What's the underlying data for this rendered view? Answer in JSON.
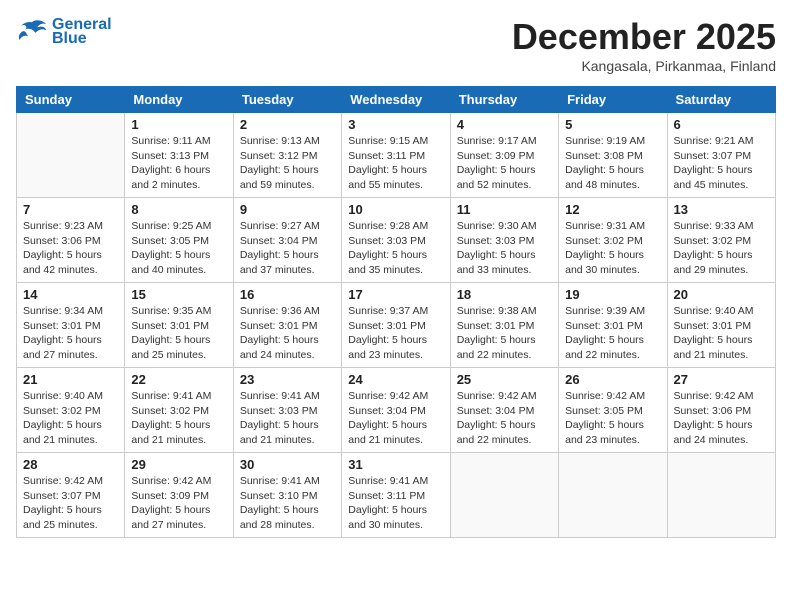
{
  "header": {
    "logo_line1": "General",
    "logo_line2": "Blue",
    "month_title": "December 2025",
    "location": "Kangasala, Pirkanmaa, Finland"
  },
  "weekdays": [
    "Sunday",
    "Monday",
    "Tuesday",
    "Wednesday",
    "Thursday",
    "Friday",
    "Saturday"
  ],
  "weeks": [
    [
      {
        "day": "",
        "info": ""
      },
      {
        "day": "1",
        "info": "Sunrise: 9:11 AM\nSunset: 3:13 PM\nDaylight: 6 hours\nand 2 minutes."
      },
      {
        "day": "2",
        "info": "Sunrise: 9:13 AM\nSunset: 3:12 PM\nDaylight: 5 hours\nand 59 minutes."
      },
      {
        "day": "3",
        "info": "Sunrise: 9:15 AM\nSunset: 3:11 PM\nDaylight: 5 hours\nand 55 minutes."
      },
      {
        "day": "4",
        "info": "Sunrise: 9:17 AM\nSunset: 3:09 PM\nDaylight: 5 hours\nand 52 minutes."
      },
      {
        "day": "5",
        "info": "Sunrise: 9:19 AM\nSunset: 3:08 PM\nDaylight: 5 hours\nand 48 minutes."
      },
      {
        "day": "6",
        "info": "Sunrise: 9:21 AM\nSunset: 3:07 PM\nDaylight: 5 hours\nand 45 minutes."
      }
    ],
    [
      {
        "day": "7",
        "info": "Sunrise: 9:23 AM\nSunset: 3:06 PM\nDaylight: 5 hours\nand 42 minutes."
      },
      {
        "day": "8",
        "info": "Sunrise: 9:25 AM\nSunset: 3:05 PM\nDaylight: 5 hours\nand 40 minutes."
      },
      {
        "day": "9",
        "info": "Sunrise: 9:27 AM\nSunset: 3:04 PM\nDaylight: 5 hours\nand 37 minutes."
      },
      {
        "day": "10",
        "info": "Sunrise: 9:28 AM\nSunset: 3:03 PM\nDaylight: 5 hours\nand 35 minutes."
      },
      {
        "day": "11",
        "info": "Sunrise: 9:30 AM\nSunset: 3:03 PM\nDaylight: 5 hours\nand 33 minutes."
      },
      {
        "day": "12",
        "info": "Sunrise: 9:31 AM\nSunset: 3:02 PM\nDaylight: 5 hours\nand 30 minutes."
      },
      {
        "day": "13",
        "info": "Sunrise: 9:33 AM\nSunset: 3:02 PM\nDaylight: 5 hours\nand 29 minutes."
      }
    ],
    [
      {
        "day": "14",
        "info": "Sunrise: 9:34 AM\nSunset: 3:01 PM\nDaylight: 5 hours\nand 27 minutes."
      },
      {
        "day": "15",
        "info": "Sunrise: 9:35 AM\nSunset: 3:01 PM\nDaylight: 5 hours\nand 25 minutes."
      },
      {
        "day": "16",
        "info": "Sunrise: 9:36 AM\nSunset: 3:01 PM\nDaylight: 5 hours\nand 24 minutes."
      },
      {
        "day": "17",
        "info": "Sunrise: 9:37 AM\nSunset: 3:01 PM\nDaylight: 5 hours\nand 23 minutes."
      },
      {
        "day": "18",
        "info": "Sunrise: 9:38 AM\nSunset: 3:01 PM\nDaylight: 5 hours\nand 22 minutes."
      },
      {
        "day": "19",
        "info": "Sunrise: 9:39 AM\nSunset: 3:01 PM\nDaylight: 5 hours\nand 22 minutes."
      },
      {
        "day": "20",
        "info": "Sunrise: 9:40 AM\nSunset: 3:01 PM\nDaylight: 5 hours\nand 21 minutes."
      }
    ],
    [
      {
        "day": "21",
        "info": "Sunrise: 9:40 AM\nSunset: 3:02 PM\nDaylight: 5 hours\nand 21 minutes."
      },
      {
        "day": "22",
        "info": "Sunrise: 9:41 AM\nSunset: 3:02 PM\nDaylight: 5 hours\nand 21 minutes."
      },
      {
        "day": "23",
        "info": "Sunrise: 9:41 AM\nSunset: 3:03 PM\nDaylight: 5 hours\nand 21 minutes."
      },
      {
        "day": "24",
        "info": "Sunrise: 9:42 AM\nSunset: 3:04 PM\nDaylight: 5 hours\nand 21 minutes."
      },
      {
        "day": "25",
        "info": "Sunrise: 9:42 AM\nSunset: 3:04 PM\nDaylight: 5 hours\nand 22 minutes."
      },
      {
        "day": "26",
        "info": "Sunrise: 9:42 AM\nSunset: 3:05 PM\nDaylight: 5 hours\nand 23 minutes."
      },
      {
        "day": "27",
        "info": "Sunrise: 9:42 AM\nSunset: 3:06 PM\nDaylight: 5 hours\nand 24 minutes."
      }
    ],
    [
      {
        "day": "28",
        "info": "Sunrise: 9:42 AM\nSunset: 3:07 PM\nDaylight: 5 hours\nand 25 minutes."
      },
      {
        "day": "29",
        "info": "Sunrise: 9:42 AM\nSunset: 3:09 PM\nDaylight: 5 hours\nand 27 minutes."
      },
      {
        "day": "30",
        "info": "Sunrise: 9:41 AM\nSunset: 3:10 PM\nDaylight: 5 hours\nand 28 minutes."
      },
      {
        "day": "31",
        "info": "Sunrise: 9:41 AM\nSunset: 3:11 PM\nDaylight: 5 hours\nand 30 minutes."
      },
      {
        "day": "",
        "info": ""
      },
      {
        "day": "",
        "info": ""
      },
      {
        "day": "",
        "info": ""
      }
    ]
  ]
}
